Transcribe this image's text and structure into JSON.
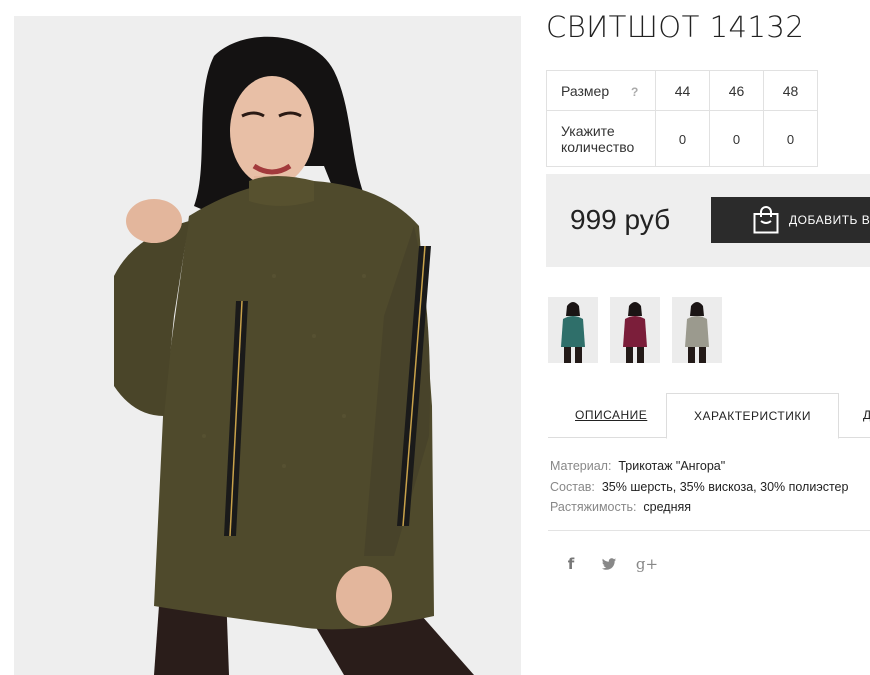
{
  "product": {
    "title": "СВИТШОТ 14132"
  },
  "sizes": {
    "size_label": "Размер",
    "help_symbol": "?",
    "qty_label": "Укажите количество",
    "options": [
      {
        "size": "44",
        "qty": "0"
      },
      {
        "size": "46",
        "qty": "0"
      },
      {
        "size": "48",
        "qty": "0"
      }
    ]
  },
  "buy": {
    "price": "999 руб",
    "add_button_label": "ДОБАВИТЬ В"
  },
  "thumbnails": [
    {
      "icon": "product-thumbnail-teal",
      "color": "#2f6f6a"
    },
    {
      "icon": "product-thumbnail-burgundy",
      "color": "#7b1e3a"
    },
    {
      "icon": "product-thumbnail-grey",
      "color": "#9b9a8e"
    }
  ],
  "tabs": {
    "description": "ОПИСАНИЕ",
    "characteristics": "ХАРАКТЕРИСТИКИ",
    "more": "Д"
  },
  "specs": {
    "material_label": "Материал:",
    "material_value": "Трикотаж \"Ангора\"",
    "composition_label": "Состав:",
    "composition_value": "35% шерсть, 35% вискоза, 30% полиэстер",
    "stretch_label": "Растяжимость:",
    "stretch_value": "средняя"
  },
  "social": {
    "facebook": "f",
    "google_plus": "g+"
  },
  "colors": {
    "button_bg": "#2b2b2b",
    "buybox_bg": "#eeeeee",
    "sweater": "#4f4a2c"
  }
}
